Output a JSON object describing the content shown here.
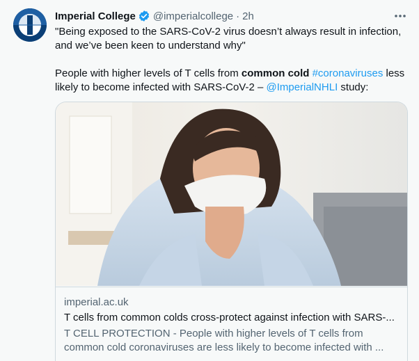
{
  "author": {
    "name": "Imperial College",
    "handle": "@imperialcollege",
    "separator": "·",
    "time": "2h",
    "avatar_icon": "imperial-logo-icon",
    "verified_icon": "verified-badge-icon"
  },
  "tweet": {
    "quote": "\"Being exposed to the SARS-CoV-2 virus doesn’t always result in infection, and we’ve been keen to understand why\"",
    "text_part1": "People with higher levels of T cells from ",
    "text_bold": "common cold",
    "text_space": " ",
    "hashtag": "#coronaviruses",
    "text_part2": " less likely to become infected with SARS-CoV-2 – ",
    "mention": "@ImperialNHLI",
    "text_part3": " study:"
  },
  "card": {
    "domain": "imperial.ac.uk",
    "title": "T cells from common colds cross-protect against infection with SARS-...",
    "description": "T CELL PROTECTION - People with higher levels of T cells from common cold coronaviruses are less likely to become infected with ..."
  },
  "more_icon": "more-options-icon",
  "colors": {
    "link": "#1d9bf0",
    "secondary_text": "#536471",
    "primary_text": "#0f1419",
    "border": "#cfd9de",
    "background": "#f7f9f9",
    "brand": "#0f4d8a"
  }
}
